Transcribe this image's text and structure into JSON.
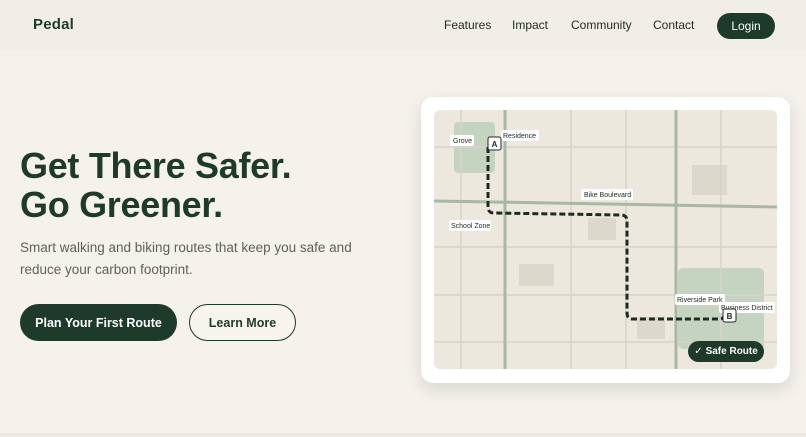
{
  "nav": {
    "brand": "Pedal",
    "links": [
      "Features",
      "Impact",
      "Community",
      "Contact"
    ],
    "login": "Login"
  },
  "hero": {
    "headline_line1": "Get There Safer.",
    "headline_line2": "Go Greener.",
    "subtitle": "Smart walking and biking routes that keep you safe and reduce your carbon footprint.",
    "primary_cta": "Plan Your First Route",
    "secondary_cta": "Learn More"
  },
  "map": {
    "labels": {
      "grove": "Grove",
      "residence": "Residence",
      "bike_boulevard": "Bike Boulevard",
      "school_zone": "School Zone",
      "riverside_park": "Riverside Park",
      "business_district": "Business District"
    },
    "marker_start": "A",
    "marker_end": "B",
    "badge_check": "✓",
    "badge_text": "Safe Route"
  },
  "colors": {
    "brand": "#1e3a2b",
    "background": "#f5f2ec",
    "map_bg": "#ece8dd",
    "park": "#c5d4c0"
  }
}
